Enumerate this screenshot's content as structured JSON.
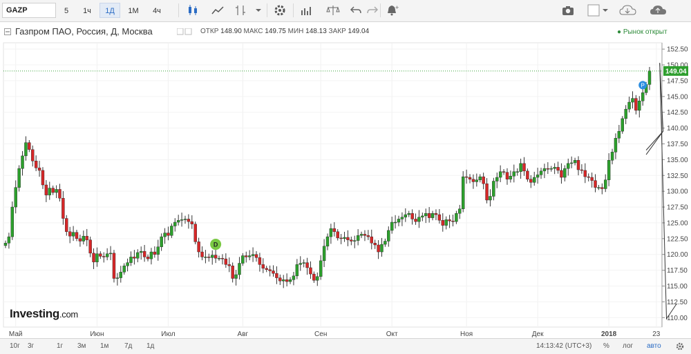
{
  "toolbar": {
    "symbol": "GAZP",
    "intervals": [
      "5",
      "1ч",
      "1Д",
      "1М",
      "4ч"
    ],
    "active_interval": "1Д",
    "icons": [
      "candles-icon",
      "line-chart-icon",
      "indicators-icon",
      "dropdown-icon",
      "settings-icon",
      "compare-icon",
      "balance-icon",
      "undo-icon",
      "redo-icon",
      "alert-icon",
      "camera-icon",
      "color-icon",
      "cloud-download-icon",
      "cloud-upload-icon"
    ]
  },
  "header": {
    "title": "Газпром ПАО, Россия, Д, Москва",
    "open_label": "ОТКР",
    "open": "148.90",
    "high_label": "МАКС",
    "high": "149.75",
    "low_label": "МИН",
    "low": "148.13",
    "close_label": "ЗАКР",
    "close": "149.04",
    "market_status": "Рынок открыт"
  },
  "logo": {
    "main": "Investing",
    "suffix": ".com"
  },
  "bottom": {
    "ranges": [
      "10г",
      "3г",
      "1г",
      "3м",
      "1м",
      "7д",
      "1д"
    ],
    "time": "14:13:42 (UTC+3)",
    "percent": "%",
    "log": "лог",
    "auto": "авто"
  },
  "chart_data": {
    "type": "candlestick",
    "ylim": [
      108.5,
      153.5
    ],
    "y_ticks": [
      "152.50",
      "150.00",
      "147.50",
      "145.00",
      "142.50",
      "140.00",
      "137.50",
      "135.00",
      "132.50",
      "130.00",
      "127.50",
      "125.00",
      "122.50",
      "120.00",
      "117.50",
      "115.00",
      "112.50",
      "110.00"
    ],
    "last_price": "149.04",
    "x_ticks": [
      {
        "label": "Май",
        "i": 3
      },
      {
        "label": "Июн",
        "i": 27
      },
      {
        "label": "Июл",
        "i": 48
      },
      {
        "label": "Авг",
        "i": 70
      },
      {
        "label": "Сен",
        "i": 93
      },
      {
        "label": "Окт",
        "i": 114
      },
      {
        "label": "Ноя",
        "i": 136
      },
      {
        "label": "Дек",
        "i": 157
      },
      {
        "label": "2018",
        "i": 178
      },
      {
        "label": "23",
        "i": 192
      }
    ],
    "closes": [
      121.8,
      122.8,
      127.5,
      130.6,
      133.6,
      135.6,
      137.7,
      136.6,
      134.8,
      133.7,
      133.3,
      131.0,
      129.4,
      130.5,
      129.8,
      130.3,
      128.9,
      125.7,
      123.6,
      122.9,
      123.5,
      122.5,
      122.1,
      122.9,
      122.3,
      120.2,
      118.8,
      120.1,
      119.7,
      119.6,
      120.1,
      120.2,
      116.2,
      116.3,
      117.2,
      118.2,
      118.7,
      119.6,
      119.4,
      120.3,
      120.5,
      119.6,
      119.3,
      120.4,
      120.0,
      121.2,
      122.8,
      123.4,
      123.0,
      124.5,
      125.1,
      125.4,
      125.5,
      125.6,
      125.2,
      124.8,
      122.0,
      120.4,
      119.6,
      119.6,
      119.5,
      119.9,
      119.4,
      119.4,
      119.3,
      118.4,
      118.2,
      116.2,
      116.8,
      118.6,
      119.8,
      119.6,
      119.8,
      120.0,
      119.5,
      118.4,
      117.8,
      117.6,
      117.4,
      117.0,
      116.3,
      115.8,
      116.0,
      115.7,
      116.0,
      116.6,
      118.4,
      118.6,
      118.7,
      117.9,
      116.9,
      115.9,
      116.5,
      119.0,
      121.3,
      122.8,
      124.1,
      123.6,
      122.6,
      122.5,
      122.7,
      122.3,
      122.1,
      122.2,
      123.0,
      123.2,
      123.0,
      122.8,
      121.8,
      121.5,
      120.4,
      121.6,
      122.1,
      123.8,
      125.1,
      125.1,
      125.6,
      125.9,
      126.3,
      126.5,
      125.6,
      125.2,
      125.9,
      126.1,
      126.5,
      125.8,
      126.5,
      126.3,
      125.4,
      124.6,
      125.5,
      125.3,
      125.2,
      126.5,
      127.2,
      132.3,
      132.2,
      131.9,
      131.5,
      131.8,
      132.3,
      131.2,
      128.6,
      129.2,
      131.6,
      132.2,
      133.1,
      133.0,
      131.9,
      132.4,
      133.1,
      133.1,
      134.4,
      133.2,
      131.9,
      131.4,
      132.2,
      132.6,
      133.2,
      133.6,
      133.5,
      133.6,
      133.8,
      133.3,
      132.2,
      133.6,
      134.4,
      134.5,
      134.9,
      133.4,
      133.3,
      132.3,
      132.2,
      131.7,
      130.6,
      130.6,
      130.4,
      131.8,
      134.9,
      136.2,
      138.4,
      139.5,
      141.5,
      143.0,
      144.1,
      144.7,
      142.8,
      144.3,
      145.6,
      146.9,
      149.04
    ]
  }
}
